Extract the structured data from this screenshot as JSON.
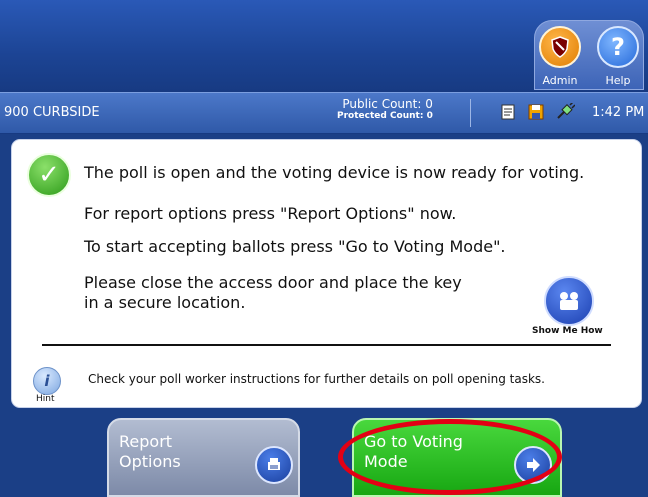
{
  "topbar": {
    "admin_label": "Admin",
    "help_label": "Help",
    "help_glyph": "?"
  },
  "status": {
    "title": "900 CURBSIDE",
    "public_count": "Public Count: 0",
    "protected_count": "Protected Count: 0",
    "time": "1:42 PM",
    "icons": [
      "report-icon",
      "save-disk-icon",
      "power-plug-icon"
    ]
  },
  "panel": {
    "line1": "The poll is open and the voting device is now ready for voting.",
    "line2": "For report options press \"Report Options\" now.",
    "line3": "To start accepting ballots press \"Go to Voting Mode\".",
    "line4a": "Please close the access door and place the key",
    "line4b": "in a secure location.",
    "show_me_how": "Show Me How",
    "hint_label": "Hint",
    "hint_text": "Check your poll worker instructions for further details on poll opening tasks."
  },
  "buttons": {
    "report_line1": "Report",
    "report_line2": "Options",
    "vote_line1": "Go to Voting",
    "vote_line2": "Mode"
  },
  "colors": {
    "topbar": "#1c4494",
    "status_bar": "#2f59a8",
    "vote_button": "#17a712",
    "report_button": "#7d8aa8",
    "highlight": "#e30014"
  }
}
